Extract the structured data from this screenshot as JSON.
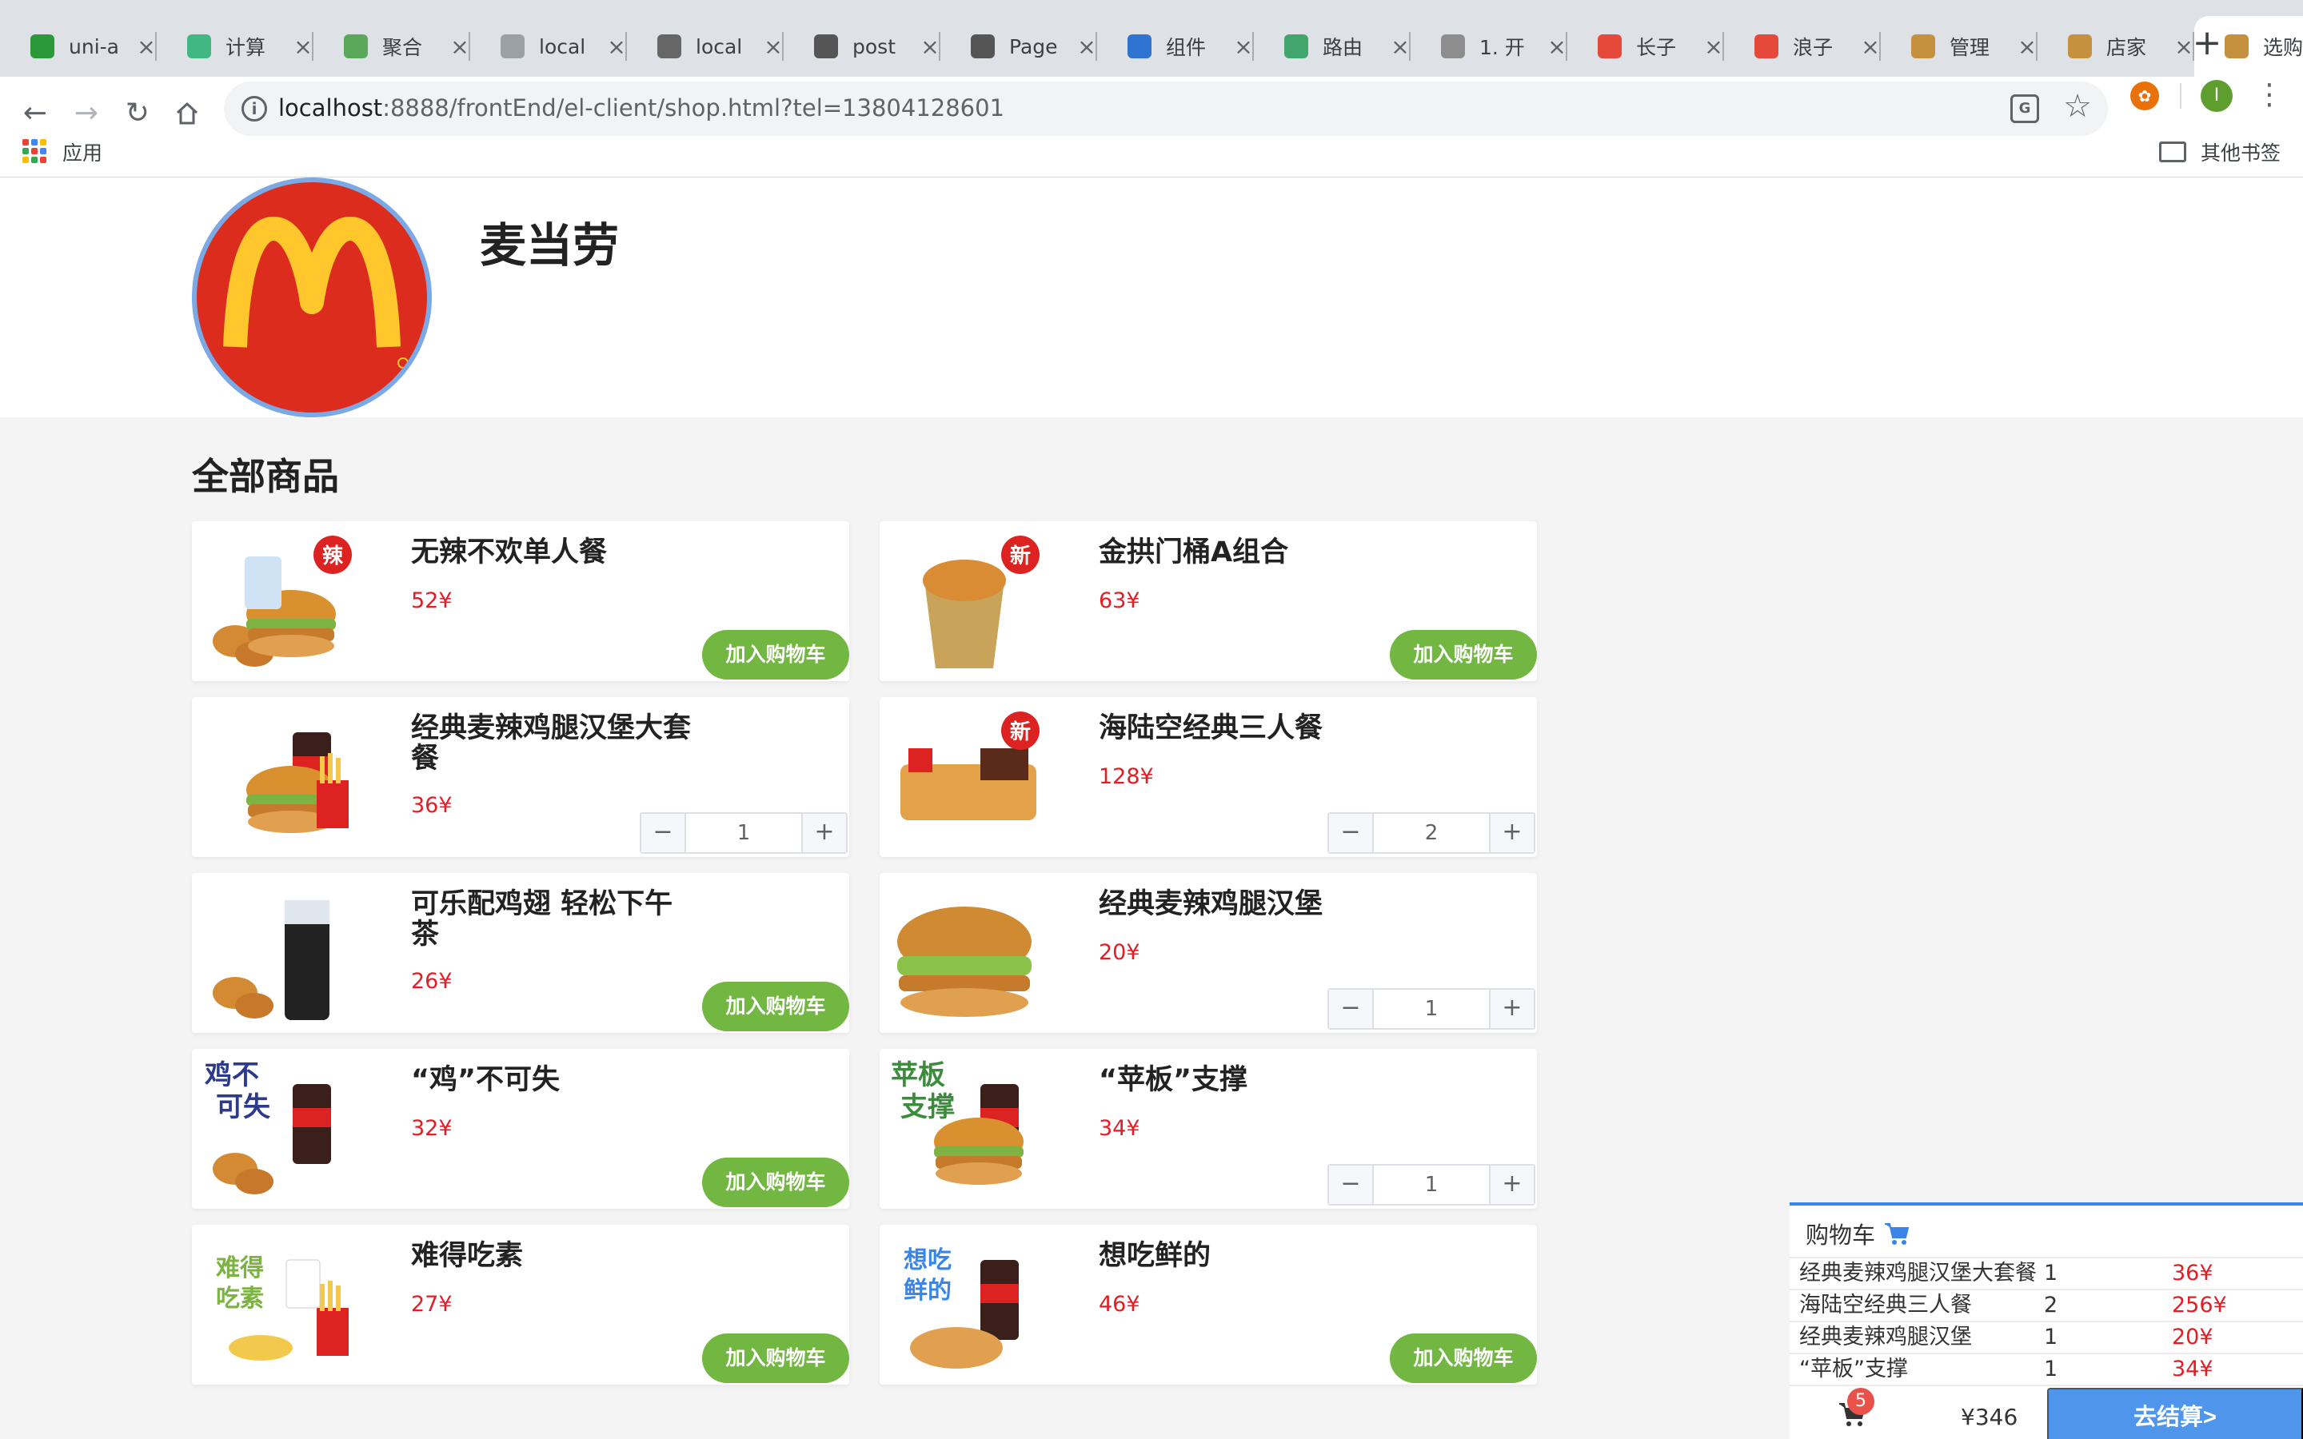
{
  "browser": {
    "tabs": [
      {
        "title": "uni-a",
        "icon": "uniapp-icon",
        "color": "#2b9939"
      },
      {
        "title": "计算",
        "icon": "vue-icon",
        "color": "#41b883"
      },
      {
        "title": "聚合",
        "icon": "cloud-icon",
        "color": "#5aa95a"
      },
      {
        "title": "local",
        "icon": "page-icon",
        "color": "#9aa0a6"
      },
      {
        "title": "local",
        "icon": "github-icon",
        "color": "#666666"
      },
      {
        "title": "post",
        "icon": "wordpress-icon",
        "color": "#555555"
      },
      {
        "title": "Page",
        "icon": "wordpress-icon",
        "color": "#555555"
      },
      {
        "title": "组件",
        "icon": "cube-icon",
        "color": "#2f74d0"
      },
      {
        "title": "路由",
        "icon": "vue-circle-icon",
        "color": "#42a56b"
      },
      {
        "title": "1. 开",
        "icon": "house-icon",
        "color": "#8d8d8d"
      },
      {
        "title": "长子",
        "icon": "video-icon",
        "color": "#e4493a"
      },
      {
        "title": "浪子",
        "icon": "video-icon",
        "color": "#e4493a"
      },
      {
        "title": "管理",
        "icon": "burger-icon",
        "color": "#c6913e"
      },
      {
        "title": "店家",
        "icon": "burger-icon",
        "color": "#c6913e"
      },
      {
        "title": "选购",
        "icon": "burger-icon",
        "color": "#c6913e"
      }
    ],
    "url_host": "localhost",
    "url_rest": ":8888/frontEnd/el-client/shop.html?tel=13804128601",
    "bookmarks": {
      "apps_label": "应用",
      "other_label": "其他书签"
    },
    "profile_initial": "I"
  },
  "shop": {
    "name": "麦当劳",
    "section_title": "全部商品",
    "add_label": "加入购物车",
    "products": [
      {
        "name": "无辣不欢单人餐",
        "price": "52¥",
        "in_cart": false,
        "qty": 0,
        "badge": "辣"
      },
      {
        "name": "金拱门桶A组合",
        "price": "63¥",
        "in_cart": false,
        "qty": 0,
        "badge": "新"
      },
      {
        "name": "经典麦辣鸡腿汉堡大套餐",
        "price": "36¥",
        "in_cart": true,
        "qty": 1,
        "badge": ""
      },
      {
        "name": "海陆空经典三人餐",
        "price": "128¥",
        "in_cart": true,
        "qty": 2,
        "badge": "新"
      },
      {
        "name": "可乐配鸡翅 轻松下午茶",
        "price": "26¥",
        "in_cart": false,
        "qty": 0,
        "badge": ""
      },
      {
        "name": "经典麦辣鸡腿汉堡",
        "price": "20¥",
        "in_cart": true,
        "qty": 1,
        "badge": ""
      },
      {
        "name": "“鸡”不可失",
        "price": "32¥",
        "in_cart": false,
        "qty": 0,
        "badge": ""
      },
      {
        "name": "“苹板”支撑",
        "price": "34¥",
        "in_cart": true,
        "qty": 1,
        "badge": ""
      },
      {
        "name": "难得吃素",
        "price": "27¥",
        "in_cart": false,
        "qty": 0,
        "badge": ""
      },
      {
        "name": "想吃鲜的",
        "price": "46¥",
        "in_cart": false,
        "qty": 0,
        "badge": ""
      }
    ]
  },
  "cart": {
    "title": "购物车",
    "rows": [
      {
        "name": "经典麦辣鸡腿汉堡大套餐",
        "qty": "1",
        "price": "36¥"
      },
      {
        "name": "海陆空经典三人餐",
        "qty": "2",
        "price": "256¥"
      },
      {
        "name": "经典麦辣鸡腿汉堡",
        "qty": "1",
        "price": "20¥"
      },
      {
        "name": "“苹板”支撑",
        "qty": "1",
        "price": "34¥"
      }
    ],
    "count": "5",
    "total": "¥346",
    "checkout_label": "去结算>"
  },
  "colors": {
    "accent_green": "#73b743",
    "price_red": "#e51c23",
    "checkout_blue": "#4f95ec",
    "logo_red": "#db2c1e",
    "logo_yellow": "#ffc72c"
  }
}
